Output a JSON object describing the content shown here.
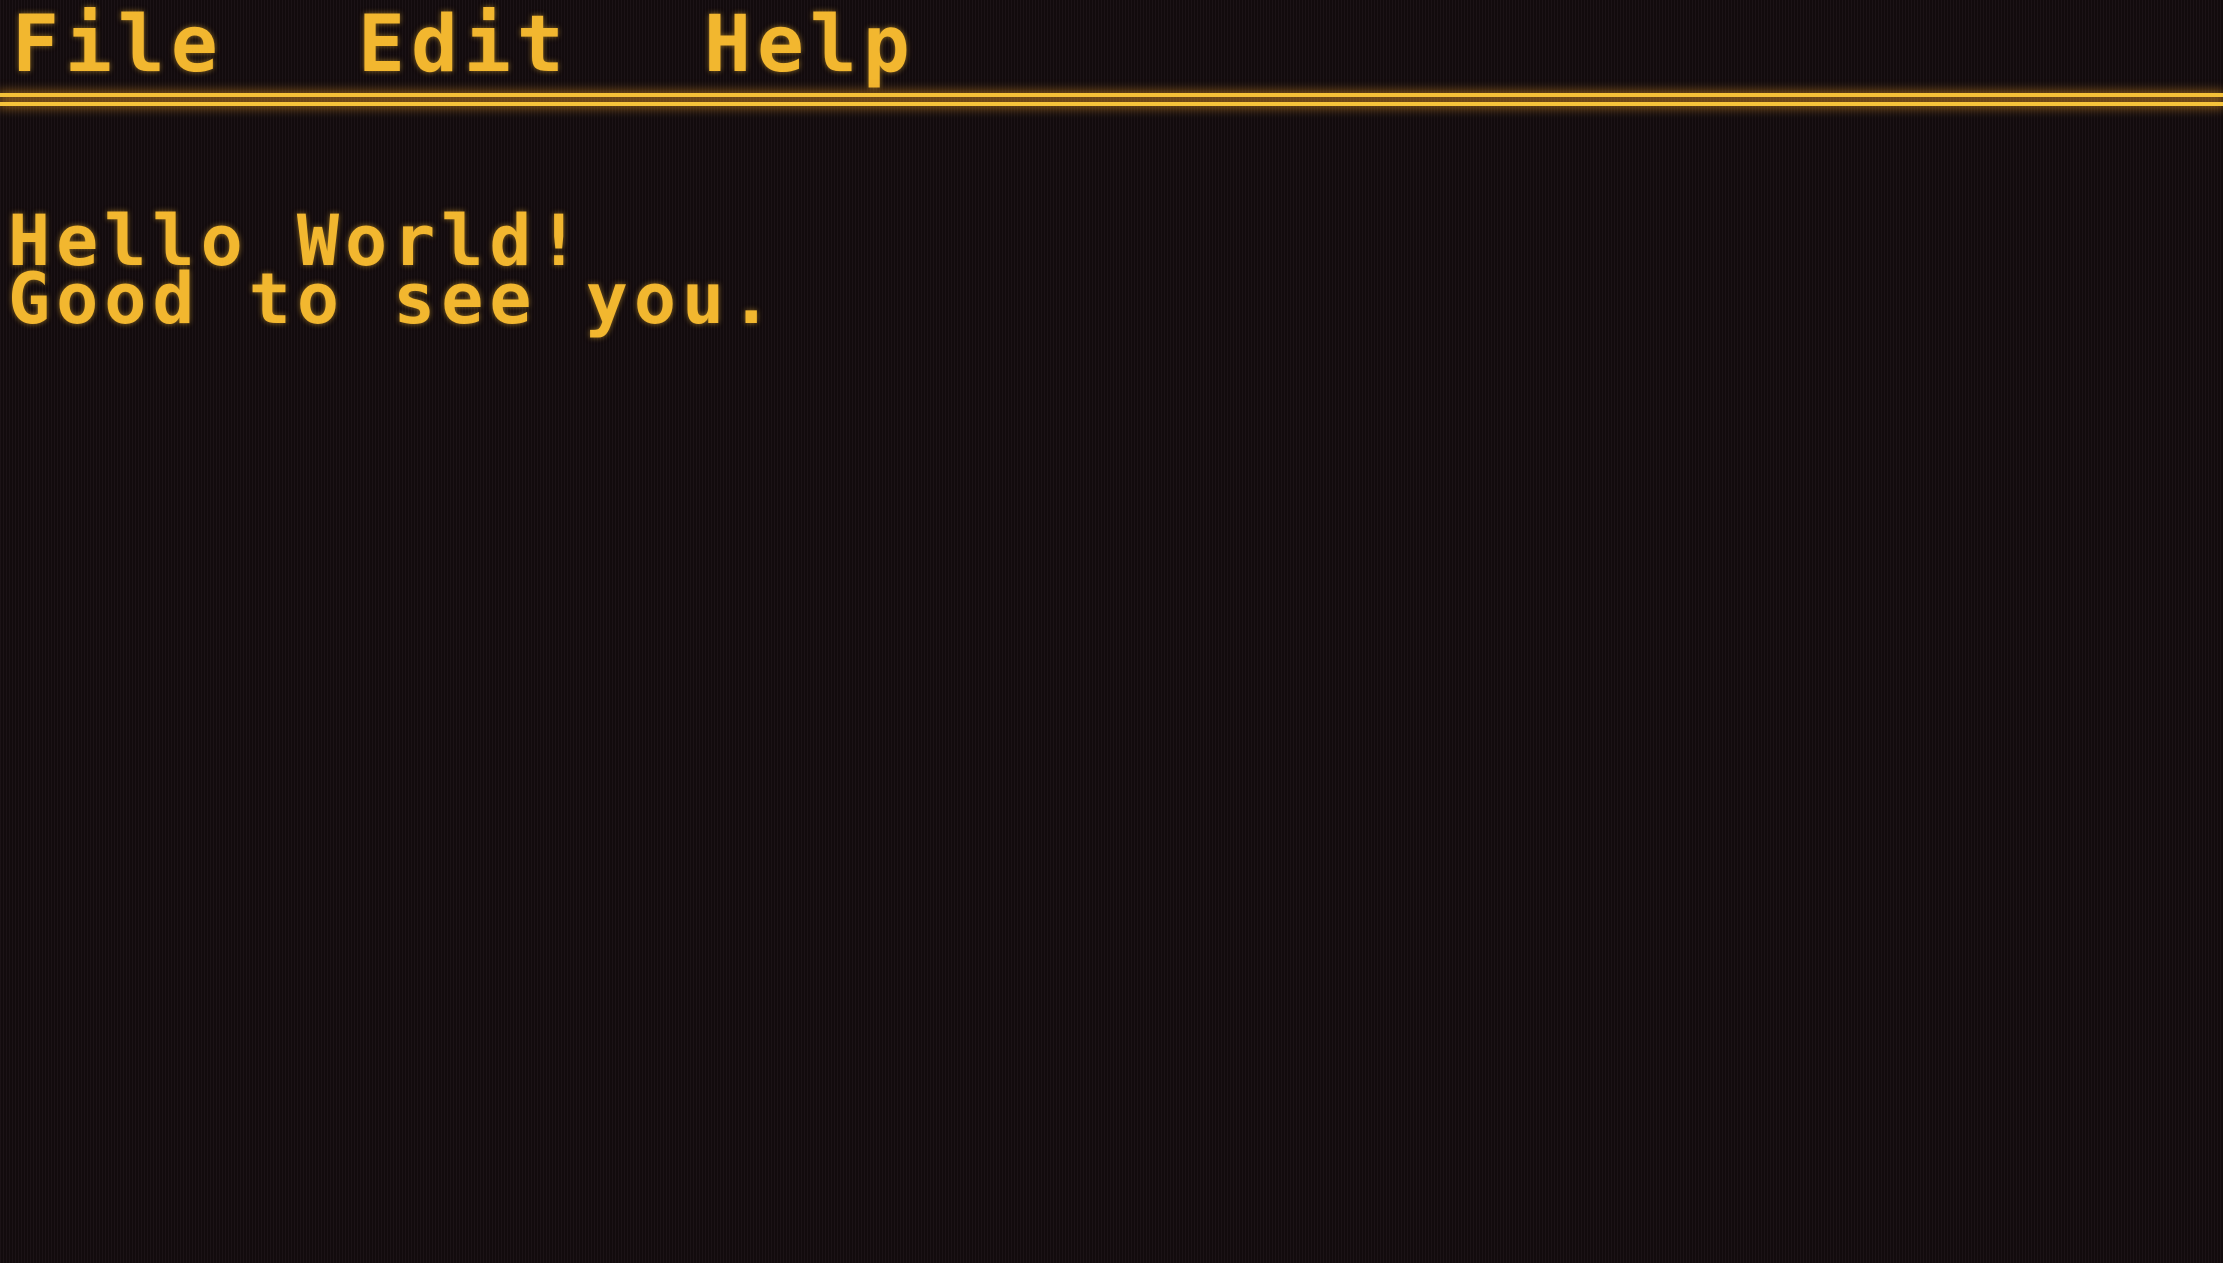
{
  "menu": {
    "items": [
      {
        "label": "File"
      },
      {
        "label": "Edit"
      },
      {
        "label": "Help"
      }
    ]
  },
  "content": {
    "lines": [
      "Hello World!",
      "Good to see you."
    ]
  },
  "theme": {
    "text_color": "#f2b72f",
    "background_color": "#160d10",
    "rule_color": "#f5c33a"
  }
}
